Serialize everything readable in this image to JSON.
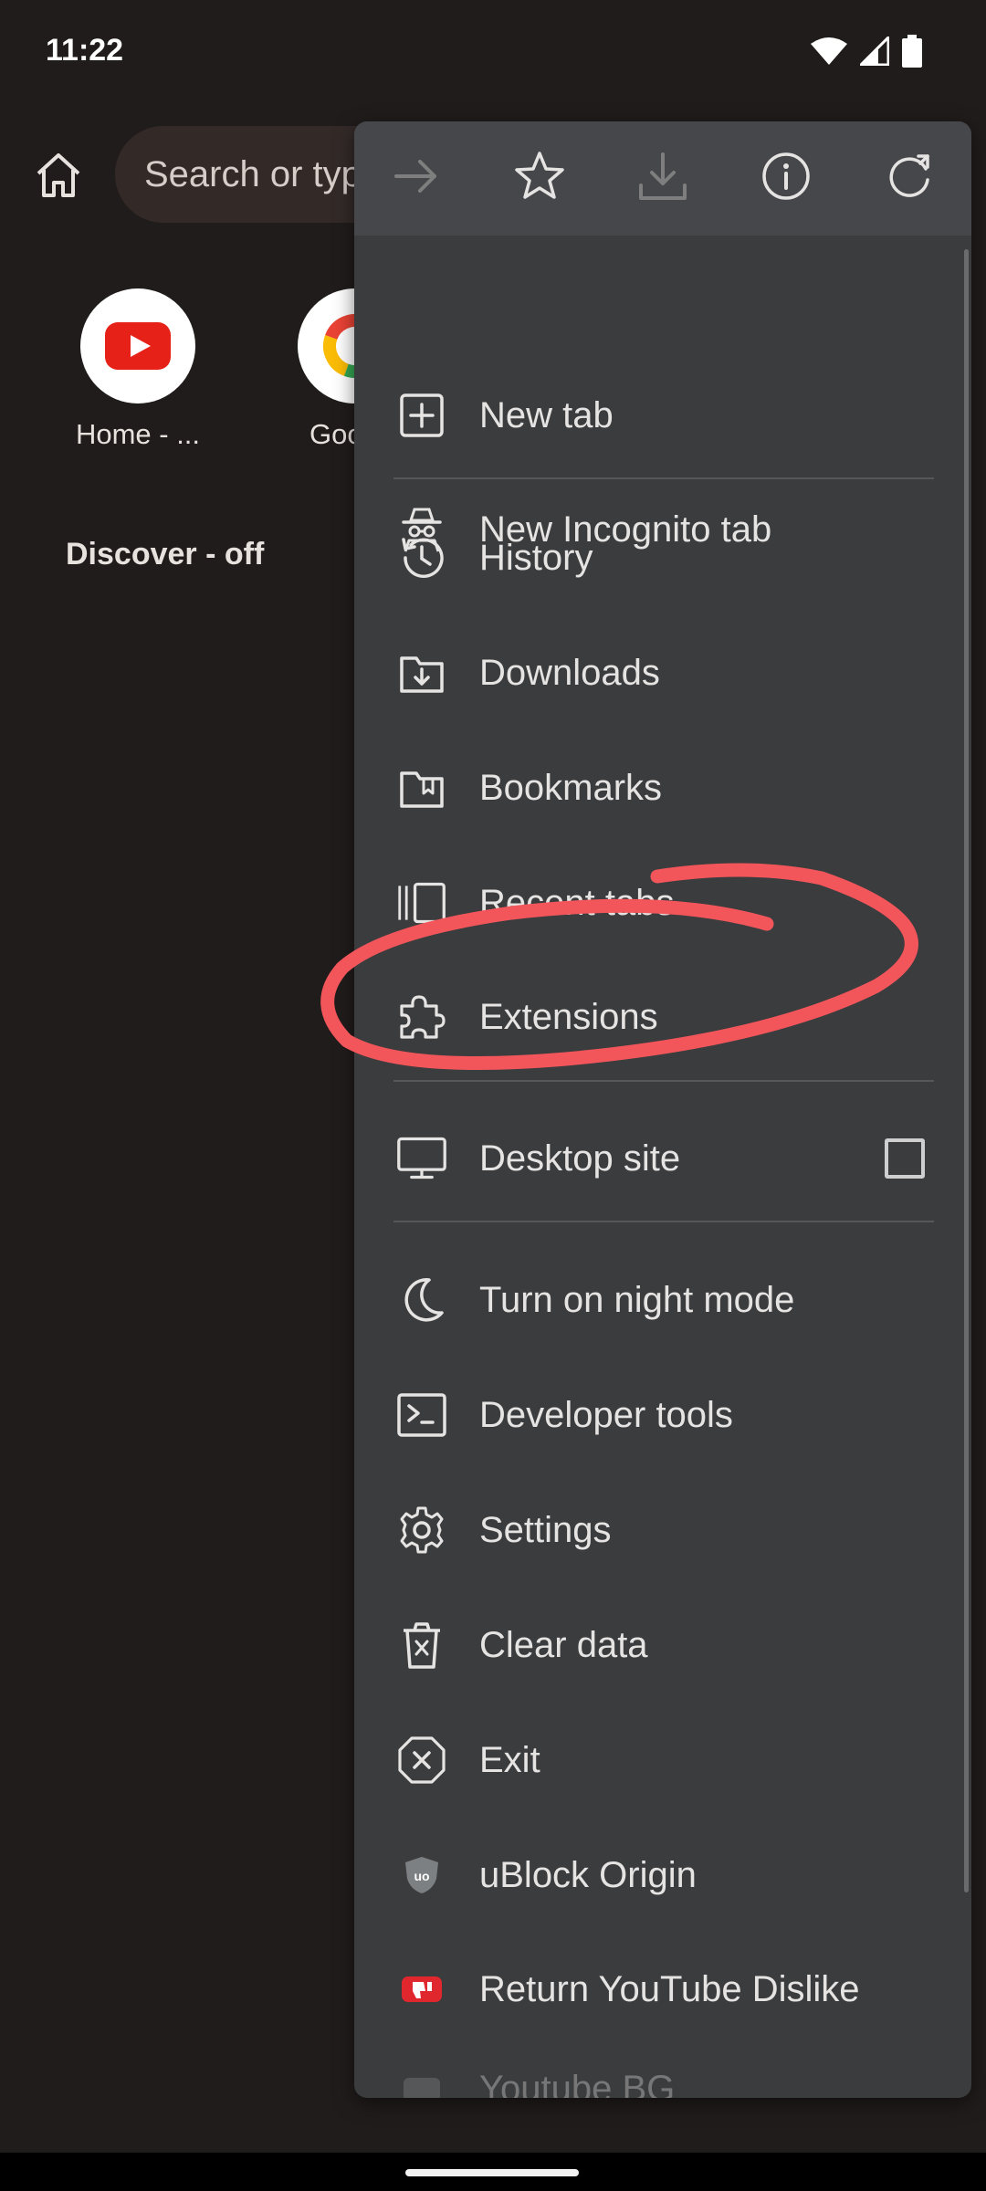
{
  "status_bar": {
    "time": "11:22"
  },
  "browser": {
    "search_placeholder": "Search or type web address",
    "shortcuts": [
      {
        "label": "Home - ...",
        "icon": "youtube-icon"
      },
      {
        "label": "Google",
        "icon": "google-icon"
      }
    ],
    "discover_label": "Discover - off"
  },
  "menu": {
    "toolbar": [
      "forward-icon",
      "star-icon",
      "download-icon",
      "info-icon",
      "reload-icon"
    ],
    "items": [
      {
        "label": "New tab",
        "icon": "new-tab-icon"
      },
      {
        "label": "New Incognito tab",
        "icon": "incognito-icon"
      },
      {
        "label": "History",
        "icon": "history-icon"
      },
      {
        "label": "Downloads",
        "icon": "downloads-icon"
      },
      {
        "label": "Bookmarks",
        "icon": "bookmarks-icon"
      },
      {
        "label": "Recent tabs",
        "icon": "recent-tabs-icon"
      },
      {
        "label": "Extensions",
        "icon": "puzzle-icon"
      },
      {
        "label": "Desktop site",
        "icon": "monitor-icon",
        "checked": false
      },
      {
        "label": "Turn on night mode",
        "icon": "moon-icon"
      },
      {
        "label": "Developer tools",
        "icon": "terminal-icon"
      },
      {
        "label": "Settings",
        "icon": "gear-icon"
      },
      {
        "label": "Clear data",
        "icon": "trash-icon"
      },
      {
        "label": "Exit",
        "icon": "exit-icon"
      },
      {
        "label": "uBlock Origin",
        "icon": "ublock-icon"
      },
      {
        "label": "Return YouTube Dislike",
        "icon": "dislike-icon"
      },
      {
        "label": "Youtube BG",
        "icon": "extension-icon"
      }
    ]
  },
  "colors": {
    "background": "#201c1b",
    "menu_background": "#3b3c3e",
    "annotation": "#f2565b"
  }
}
